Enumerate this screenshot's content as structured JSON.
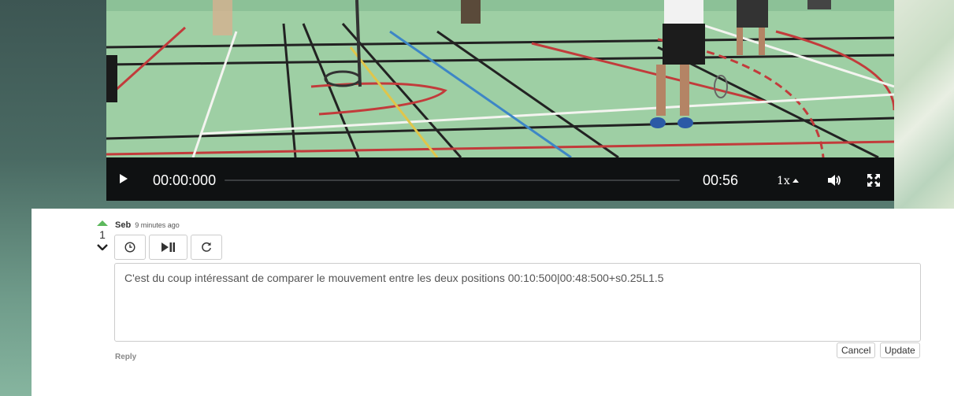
{
  "player": {
    "current_time": "00:00:000",
    "duration": "00:56",
    "speed": "1x",
    "progress": 0
  },
  "comment": {
    "author": "Seb",
    "time_ago": "9 minutes ago",
    "votes": "1",
    "text": "C'est du coup intéressant de comparer le mouvement entre les deux positions 00:10:500|00:48:500+s0.25L1.5",
    "cancel_label": "Cancel",
    "update_label": "Update",
    "reply_label": "Reply"
  },
  "colors": {
    "upvote": "#5cb85c",
    "controls_bg": "#0f1112",
    "court_floor": "#9ecfa4"
  },
  "icons": {
    "play": "play-icon",
    "volume": "volume-icon",
    "fullscreen": "fullscreen-icon",
    "timestamp": "clock-icon",
    "play_pause": "play-pause-icon",
    "reset": "refresh-icon",
    "upvote": "upvote-arrow-icon",
    "downvote": "downvote-arrow-icon"
  }
}
